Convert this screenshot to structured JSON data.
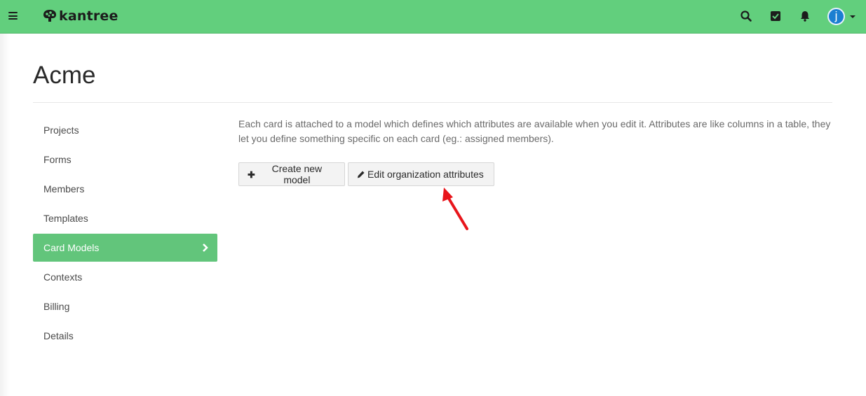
{
  "app": {
    "logo_text": "kantree",
    "avatar_letter": "j"
  },
  "header_icons": [
    "menu-icon",
    "search-icon",
    "checkbox-icon",
    "bell-icon",
    "avatar",
    "chevron-down-icon"
  ],
  "page": {
    "title": "Acme"
  },
  "sidebar": {
    "items": [
      {
        "label": "Projects",
        "active": false
      },
      {
        "label": "Forms",
        "active": false
      },
      {
        "label": "Members",
        "active": false
      },
      {
        "label": "Templates",
        "active": false
      },
      {
        "label": "Card Models",
        "active": true
      },
      {
        "label": "Contexts",
        "active": false
      },
      {
        "label": "Billing",
        "active": false
      },
      {
        "label": "Details",
        "active": false
      }
    ]
  },
  "main": {
    "description": "Each card is attached to a model which defines which attributes are available when you edit it. Attributes are like columns in a table, they let you define something specific on each card (eg.: assigned members).",
    "buttons": {
      "create_label": "Create new model",
      "edit_label": "Edit organization attributes"
    }
  },
  "colors": {
    "topbar": "#62cf7d",
    "active_nav": "#62c57b",
    "avatar": "#1b7fd1",
    "annotation_arrow": "#e8151b"
  }
}
